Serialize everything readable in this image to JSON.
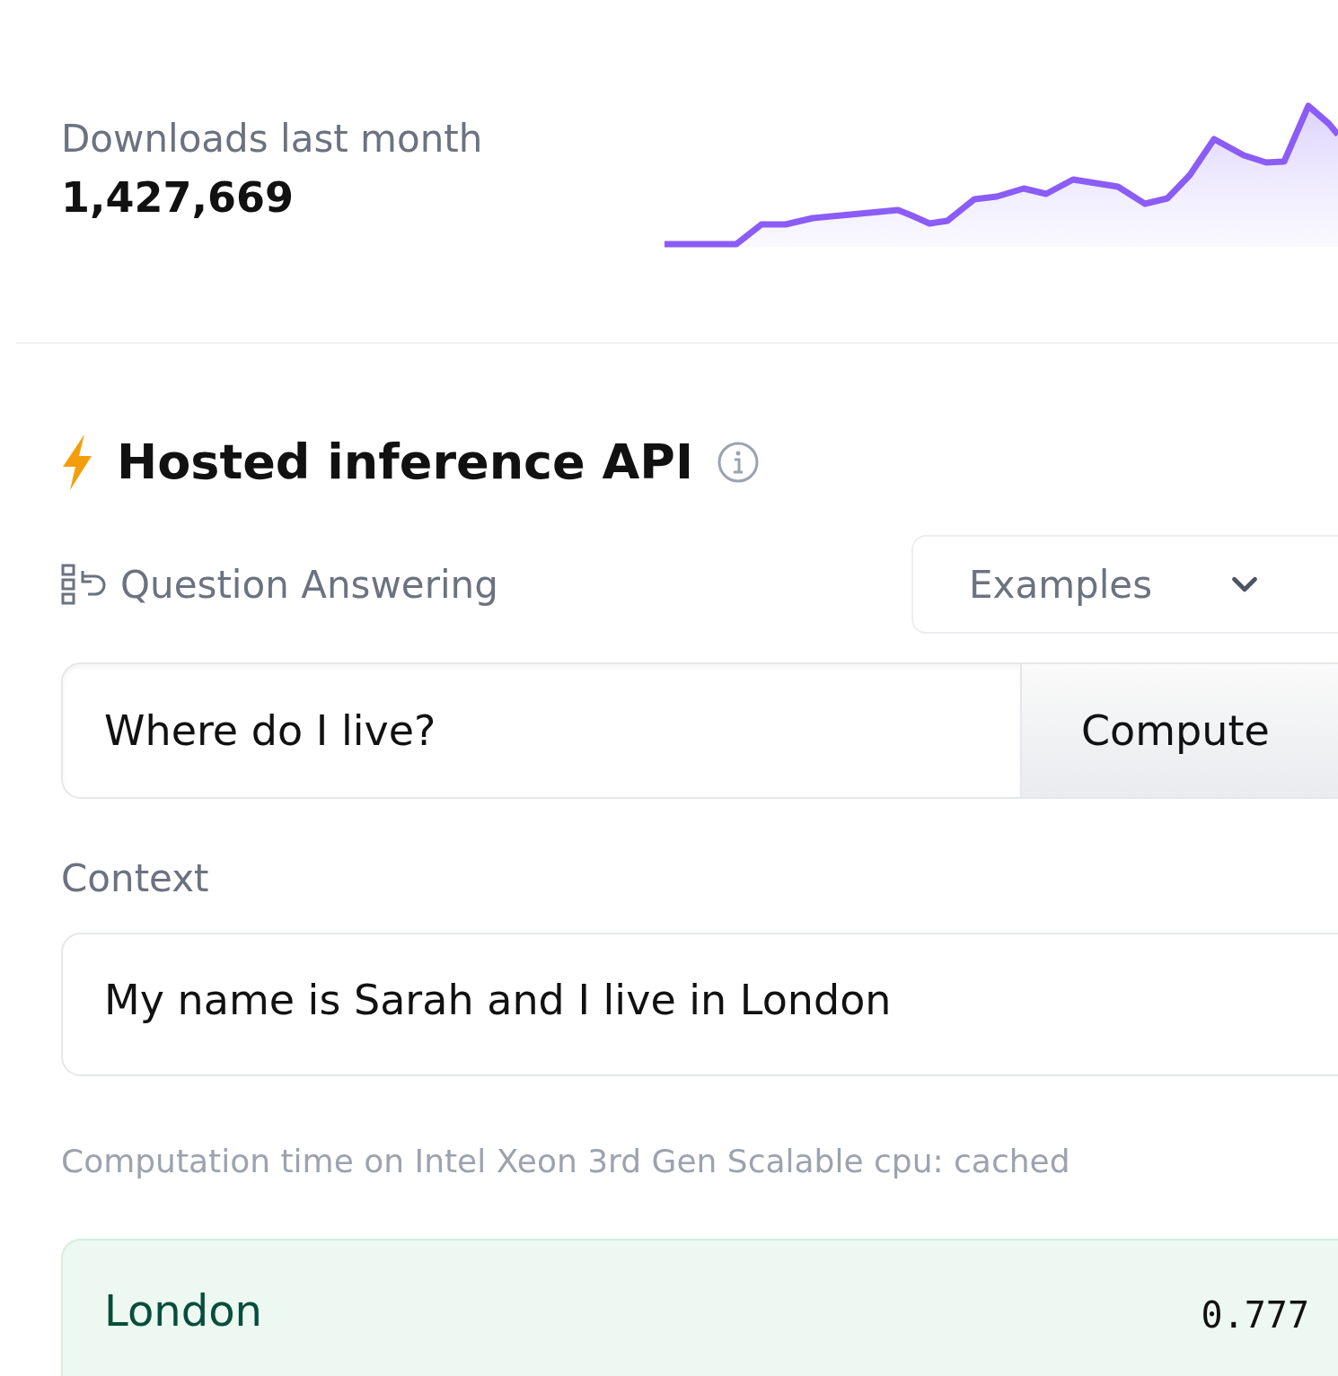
{
  "downloads": {
    "label": "Downloads last month",
    "value": "1,427,669"
  },
  "inference": {
    "title": "Hosted inference API",
    "task": "Question Answering",
    "examples": "Examples",
    "question": "Where do I live?",
    "compute": "Compute",
    "context_label": "Context",
    "context": "My name is Sarah and I live in London",
    "note": "Computation time on Intel Xeon 3rd Gen Scalable cpu: cached",
    "result": {
      "answer": "London",
      "score": "0.777"
    }
  }
}
